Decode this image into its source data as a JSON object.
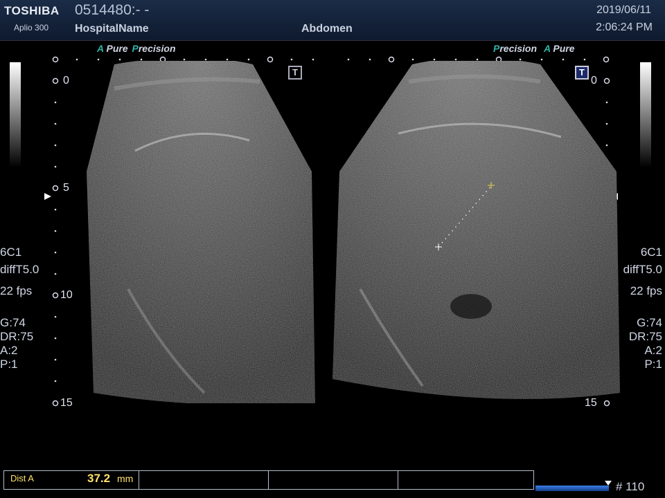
{
  "header": {
    "brand": "TOSHIBA",
    "model": "Aplio 300",
    "patient_id": "0514480:- -",
    "hospital": "HospitalName",
    "preset": "Abdomen",
    "date": "2019/06/11",
    "time": "2:06:24 PM"
  },
  "left_labels": {
    "a": "A",
    "pure": "Pure",
    "p": "P",
    "recision": "recision"
  },
  "right_labels": {
    "p": "P",
    "recision": "recision",
    "a": "A",
    "pure": "Pure"
  },
  "depth_scale": {
    "d0": "0",
    "d5": "5",
    "d10": "10",
    "d15": "15"
  },
  "left_params": {
    "transducer": "6C1",
    "mode": "diffT5.0",
    "fps": "22 fps",
    "gain": "G:74",
    "dr": "DR:75",
    "a": "A:2",
    "p": "P:1"
  },
  "right_params": {
    "transducer": "6C1",
    "mode": "diffT5.0",
    "fps": "22 fps",
    "gain": "G:74",
    "dr": "DR:75",
    "a": "A:2",
    "p": "P:1"
  },
  "t_icon": "T",
  "measurement": {
    "label": "Dist A",
    "value": "37.2",
    "unit": "mm"
  },
  "frame_number": "# 110",
  "colors": {
    "accent": "#2cb3a8",
    "measure": "#ffe36b",
    "header": "#1b2c47"
  }
}
